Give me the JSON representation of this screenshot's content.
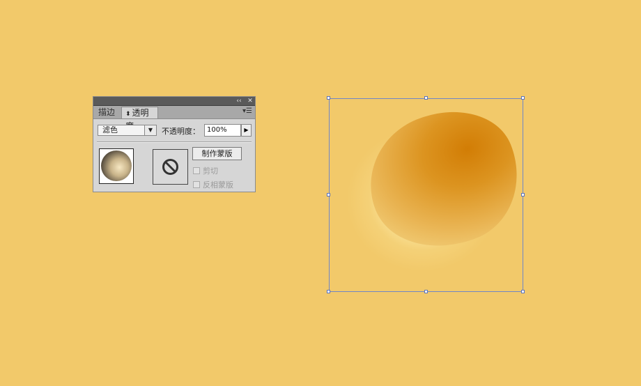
{
  "panel": {
    "collapse_icon": "double-chevron-left-icon",
    "collapse_glyph": "‹‹",
    "close_glyph": "✕",
    "menu_glyph": "▾☰",
    "tabs": [
      {
        "label": "描边"
      },
      {
        "label": "透明度"
      }
    ],
    "blend_mode": "滤色",
    "opacity_label": "不透明度：",
    "opacity_value": "100%",
    "make_mask_label": "制作蒙版",
    "clip_label": "剪切",
    "invert_mask_label": "反相蒙版"
  },
  "colors": {
    "canvas_background": "#f2c96a",
    "selection_outline": "#6f86c7"
  }
}
